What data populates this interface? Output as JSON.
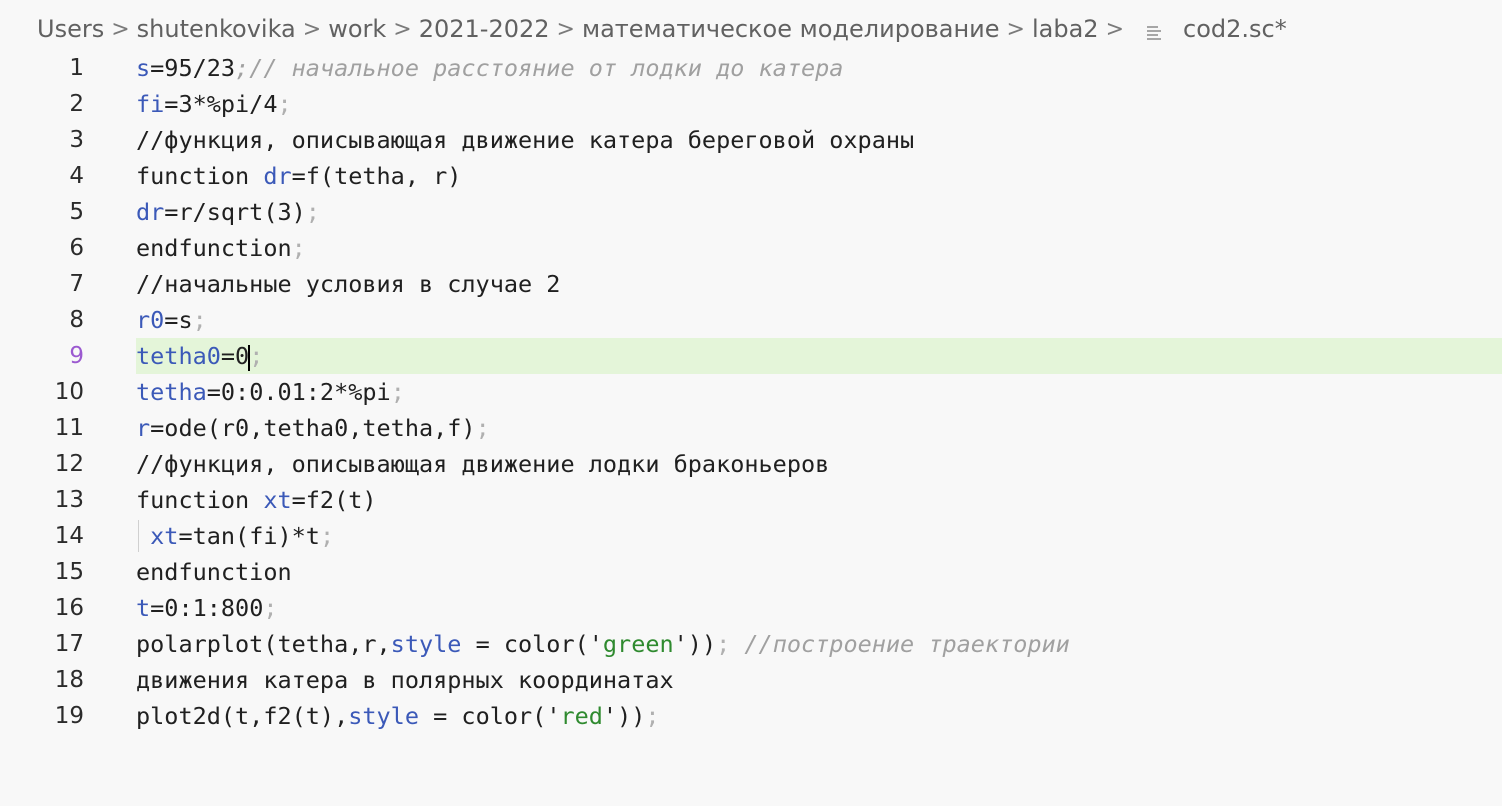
{
  "breadcrumb": {
    "items": [
      "Users",
      "shutenkovika",
      "work",
      "2021-2022",
      "математическое моделирование",
      "laba2"
    ],
    "file": "cod2.sc*",
    "separator": ">"
  },
  "editor": {
    "current_line": 9,
    "lines": [
      {
        "n": "1",
        "tokens": [
          [
            "var",
            "s"
          ],
          [
            "plain",
            "=95/23"
          ],
          [
            "comment",
            ";// начальное расстояние от лодки до катера"
          ]
        ]
      },
      {
        "n": "2",
        "tokens": [
          [
            "var",
            "fi"
          ],
          [
            "plain",
            "=3*%pi/4"
          ],
          [
            "punct",
            ";"
          ]
        ]
      },
      {
        "n": "3",
        "tokens": [
          [
            "plain",
            "//функция, описывающая движение катера береговой охраны"
          ]
        ]
      },
      {
        "n": "4",
        "tokens": [
          [
            "plain",
            "function "
          ],
          [
            "var",
            "dr"
          ],
          [
            "plain",
            "=f(tetha, r)"
          ]
        ]
      },
      {
        "n": "5",
        "tokens": [
          [
            "var",
            "dr"
          ],
          [
            "plain",
            "=r/sqrt(3)"
          ],
          [
            "punct",
            ";"
          ]
        ]
      },
      {
        "n": "6",
        "tokens": [
          [
            "plain",
            "endfunction"
          ],
          [
            "punct",
            ";"
          ]
        ]
      },
      {
        "n": "7",
        "tokens": [
          [
            "plain",
            "//начальные условия в случае 2"
          ]
        ]
      },
      {
        "n": "8",
        "tokens": [
          [
            "var",
            "r0"
          ],
          [
            "plain",
            "=s"
          ],
          [
            "punct",
            ";"
          ]
        ]
      },
      {
        "n": "9",
        "tokens": [
          [
            "var",
            "tetha0"
          ],
          [
            "plain",
            "=0"
          ],
          [
            "caret",
            ""
          ],
          [
            "punct",
            ";"
          ]
        ]
      },
      {
        "n": "10",
        "tokens": [
          [
            "var",
            "tetha"
          ],
          [
            "plain",
            "=0:0.01:2*%pi"
          ],
          [
            "punct",
            ";"
          ]
        ]
      },
      {
        "n": "11",
        "tokens": [
          [
            "var",
            "r"
          ],
          [
            "plain",
            "=ode(r0,tetha0,tetha,f)"
          ],
          [
            "punct",
            ";"
          ]
        ]
      },
      {
        "n": "12",
        "tokens": [
          [
            "plain",
            "//функция, описывающая движение лодки браконьеров"
          ]
        ]
      },
      {
        "n": "13",
        "tokens": [
          [
            "plain",
            "function "
          ],
          [
            "var",
            "xt"
          ],
          [
            "plain",
            "=f2(t)"
          ]
        ]
      },
      {
        "n": "14",
        "indent": true,
        "tokens": [
          [
            "plain",
            " "
          ],
          [
            "var",
            "xt"
          ],
          [
            "plain",
            "=tan(fi)*t"
          ],
          [
            "punct",
            ";"
          ]
        ]
      },
      {
        "n": "15",
        "tokens": [
          [
            "plain",
            "endfunction"
          ]
        ]
      },
      {
        "n": "16",
        "tokens": [
          [
            "var",
            "t"
          ],
          [
            "plain",
            "=0:1:800"
          ],
          [
            "punct",
            ";"
          ]
        ]
      },
      {
        "n": "17",
        "tokens": [
          [
            "plain",
            "polarplot(tetha,r,"
          ],
          [
            "var",
            "style"
          ],
          [
            "plain",
            " = color('"
          ],
          [
            "string",
            "green"
          ],
          [
            "plain",
            "'))"
          ],
          [
            "punct",
            ";"
          ],
          [
            "comment",
            " //построение траектории"
          ]
        ]
      },
      {
        "n": "18",
        "tokens": [
          [
            "plain",
            "движения катера в полярных координатах"
          ]
        ]
      },
      {
        "n": "19",
        "tokens": [
          [
            "plain",
            "plot2d(t,f2(t),"
          ],
          [
            "var",
            "style"
          ],
          [
            "plain",
            " = color('"
          ],
          [
            "string",
            "red"
          ],
          [
            "plain",
            "'))"
          ],
          [
            "punct",
            ";"
          ]
        ]
      }
    ]
  },
  "colors": {
    "variable": "#3b59b8",
    "comment": "#a0a0a0",
    "string": "#2f8a2f",
    "current_line_bg": "#e4f5d9",
    "current_line_number": "#9b59d0"
  },
  "icons": {
    "file": "file-lines-icon",
    "separator": "chevron-right-icon"
  }
}
